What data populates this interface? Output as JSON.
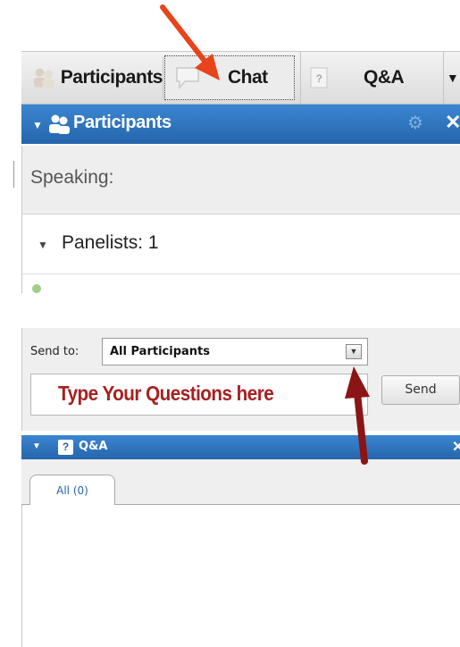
{
  "top_panel": {
    "tabs": [
      {
        "label": "Participants",
        "icon": "participants-icon"
      },
      {
        "label": "Chat",
        "icon": "chat-bubble-icon"
      },
      {
        "label": "Q&A",
        "icon": "question-icon"
      }
    ],
    "more_glyph": "▼",
    "header": {
      "title": "Participants",
      "collapse_glyph": "▼",
      "settings_glyph": "⚙",
      "close_glyph": "✕"
    },
    "speaking_label": "Speaking:",
    "panelists": {
      "glyph": "▼",
      "label": "Panelists: 1"
    }
  },
  "chat": {
    "send_to_label": "Send to:",
    "send_to_value": "All Participants",
    "dropdown_glyph": "▼",
    "input_text": "Type Your Questions here",
    "send_label": "Send"
  },
  "qa_panel": {
    "header": {
      "collapse_glyph": "▼",
      "icon_glyph": "?",
      "title": "Q&A",
      "close_glyph": "✕"
    },
    "tab_label": "All (0)"
  },
  "colors": {
    "header_blue": "#2a6db5",
    "annotation_arrow_orange": "#e8431b",
    "annotation_arrow_darkred": "#8b1515",
    "input_text_red": "#a82020"
  }
}
